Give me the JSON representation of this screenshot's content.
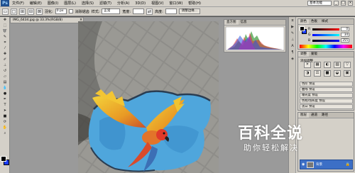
{
  "app": {
    "logo": "Ps"
  },
  "menubar": {
    "items": [
      "文件(F)",
      "编辑(E)",
      "图像(I)",
      "图层(L)",
      "选择(S)",
      "滤镜(T)",
      "分析(A)",
      "3D(D)",
      "视图(V)",
      "窗口(W)",
      "帮助(H)"
    ],
    "workspace": "基本功能",
    "min": "_",
    "max": "□",
    "close": "×"
  },
  "optbar": {
    "feather_label": "羽化:",
    "feather_value": "0 px",
    "antialias_label": "消除锯齿",
    "style_label": "样式:",
    "style_value": "正常",
    "width_label": "宽度:",
    "height_label": "高度:",
    "refine_button": "调整边缘..."
  },
  "document": {
    "tab_title": "IMG_6434.jpg @ 33.3%(RGB/8)",
    "close": "×"
  },
  "histogram": {
    "tabs": [
      "直方图",
      "信息"
    ]
  },
  "color": {
    "tabs": [
      "颜色",
      "色板",
      "样式"
    ],
    "sliders": [
      {
        "label": "R",
        "value": "0"
      },
      {
        "label": "G",
        "value": "34"
      },
      {
        "label": "B",
        "value": "255"
      }
    ],
    "foreground": "#000000",
    "background": "#1a3cff"
  },
  "adjustments": {
    "tabs": [
      "调整",
      "蒙版"
    ],
    "title": "添加调整",
    "icons": [
      "☀",
      "▦",
      "◐",
      "▨",
      "▽",
      "◑",
      "⚖",
      "■",
      "◒",
      "▣"
    ],
    "presets": [
      "色阶 预设",
      "曲线 预设",
      "曝光度 预设",
      "色相/饱和度 预设",
      "黑白 预设"
    ]
  },
  "layers": {
    "tabs": [
      "图层",
      "通道",
      "路径"
    ],
    "layer_name": "背景"
  },
  "watermark": {
    "title": "百科全说",
    "subtitle": "助你轻松解决"
  },
  "colors": {
    "accent": "#3c6fc6",
    "chrome": "#d4d0c8",
    "workspace": "#9a9a9a"
  }
}
